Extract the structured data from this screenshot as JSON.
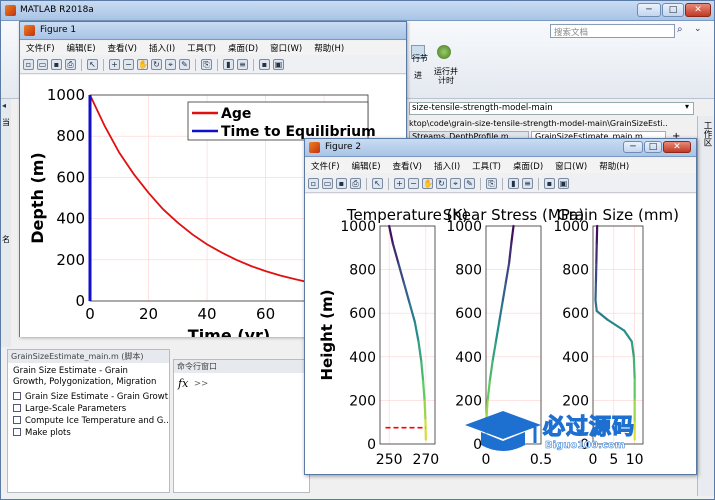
{
  "matlab": {
    "title": "MATLAB R2018a",
    "search_placeholder": "搜索文档",
    "ribbon_items": [
      "行节",
      "运行并\n计时"
    ],
    "ribbon_sub": "进",
    "path": "size-tensile-strength-model-main",
    "path_full": "ktop\\code\\grain-size-tensile-strength-model-main\\GrainSizeEsti...",
    "tabs": [
      "Streams_DepthProfile.m",
      "GrainSizeEstimate_main.m"
    ],
    "panel_title": "GrainSizeEstimate_main.m (脚本)",
    "desc": "Grain Size Estimate - Grain Growth, Polygonization, Migration",
    "outline": [
      "Grain Size Estimate - Grain Growt...",
      "Large-Scale Parameters",
      "Compute Ice Temperature and G...",
      "Make plots"
    ],
    "cmd_title": "命令行窗口",
    "prompt": ">>",
    "side_label": "工作区",
    "left_letters": [
      "当",
      "名"
    ]
  },
  "figure1": {
    "title": "Figure 1",
    "menus": [
      "文件(F)",
      "编辑(E)",
      "查看(V)",
      "插入(I)",
      "工具(T)",
      "桌面(D)",
      "窗口(W)",
      "帮助(H)"
    ],
    "chart_data": {
      "type": "line",
      "xlabel": "Time (yr)",
      "ylabel": "Depth (m)",
      "xlim": [
        0,
        95
      ],
      "ylim": [
        0,
        1000
      ],
      "xticks": [
        0,
        20,
        40,
        60,
        80
      ],
      "yticks": [
        0,
        200,
        400,
        600,
        800,
        1000
      ],
      "grid": true,
      "legend_position": "top-right",
      "series": [
        {
          "name": "Age",
          "color": "#e01010",
          "x": [
            0,
            5,
            10,
            15,
            20,
            25,
            30,
            35,
            40,
            45,
            50,
            55,
            60,
            65,
            70,
            75,
            80,
            85,
            90,
            95
          ],
          "y": [
            1000,
            850,
            720,
            615,
            525,
            445,
            380,
            323,
            275,
            235,
            200,
            170,
            145,
            124,
            106,
            90,
            77,
            66,
            56,
            48
          ]
        },
        {
          "name": "Time to Equilibrium",
          "color": "#1010c8",
          "x": [
            0,
            0
          ],
          "y": [
            0,
            1000
          ]
        }
      ]
    }
  },
  "figure2": {
    "title": "Figure 2",
    "menus": [
      "文件(F)",
      "编辑(E)",
      "查看(V)",
      "插入(I)",
      "工具(T)",
      "桌面(D)",
      "窗口(W)",
      "帮助(H)"
    ],
    "chart_data": [
      {
        "type": "line",
        "title": "Temperature (K)",
        "ylabel": "Height (m)",
        "xlim": [
          245,
          275
        ],
        "ylim": [
          0,
          1000
        ],
        "xticks": [
          250,
          270
        ],
        "yticks": [
          0,
          200,
          400,
          600,
          800,
          1000
        ],
        "series": [
          {
            "x": [
              250,
              252,
              255,
              258,
              261,
              264,
              266,
              267.5,
              268.5,
              269.3,
              269.8,
              270
            ],
            "y": [
              1000,
              920,
              830,
              740,
              650,
              560,
              470,
              380,
              290,
              200,
              110,
              20
            ]
          }
        ],
        "dashed_line": {
          "y": 75,
          "x": [
            248,
            270
          ],
          "color": "#ff0000"
        }
      },
      {
        "type": "line",
        "title": "Shear Stress (MPa)",
        "xlim": [
          0,
          0.5
        ],
        "ylim": [
          0,
          1000
        ],
        "xticks": [
          0,
          0.5
        ],
        "series": [
          {
            "x": [
              0.25,
              0.23,
              0.21,
              0.18,
              0.15,
              0.12,
              0.09,
              0.06,
              0.035,
              0.015,
              0.003,
              0
            ],
            "y": [
              1000,
              920,
              830,
              740,
              650,
              560,
              470,
              380,
              290,
              200,
              110,
              20
            ]
          }
        ]
      },
      {
        "type": "line",
        "title": "Grain Size (mm)",
        "xlim": [
          0,
          12
        ],
        "ylim": [
          0,
          1000
        ],
        "xticks": [
          0,
          5,
          10
        ],
        "series": [
          {
            "x": [
              1,
              0.9,
              0.8,
              0.7,
              0.6,
              0.9,
              3.5,
              7.5,
              9.3,
              9.8,
              10,
              10,
              10,
              10
            ],
            "y": [
              1000,
              920,
              830,
              740,
              660,
              610,
              570,
              520,
              470,
              400,
              300,
              200,
              100,
              20
            ]
          }
        ]
      }
    ]
  },
  "watermark": {
    "main": "必过源码",
    "sub": "Biguo100.com"
  }
}
